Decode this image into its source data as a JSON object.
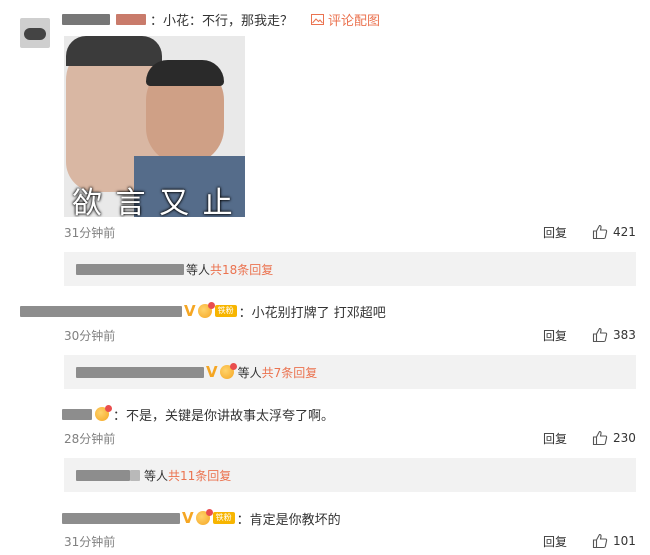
{
  "thread": {
    "c1": {
      "text": "：小花：不行，那我走？",
      "pic_link": "评论配图",
      "image_caption": "欲 言 又 止",
      "time": "31分钟前",
      "reply": "回复",
      "likes": "421",
      "sub_suffix": "等人",
      "sub_total": "共18条回复"
    },
    "c2": {
      "fan_badge": "铁粉",
      "text": "：小花别打牌了 打邓超吧",
      "time": "30分钟前",
      "reply": "回复",
      "likes": "383",
      "sub_suffix": "等人",
      "sub_total": "共7条回复"
    },
    "c3": {
      "text": "：不是，关键是你讲故事太浮夸了啊。",
      "time": "28分钟前",
      "reply": "回复",
      "likes": "230",
      "sub_suffix": "等人",
      "sub_total": "共11条回复"
    },
    "c4": {
      "fan_badge": "铁粉",
      "text": "：肯定是你教坏的",
      "time": "31分钟前",
      "reply": "回复",
      "likes": "101"
    }
  },
  "colors": {
    "accent": "#eb7350",
    "muted": "#808080",
    "subbar_bg": "#f2f2f2",
    "v_badge": "#f5a623"
  },
  "icons": {
    "like": "thumbs-up-icon",
    "picture": "picture-icon",
    "verified": "verified-v-icon"
  }
}
